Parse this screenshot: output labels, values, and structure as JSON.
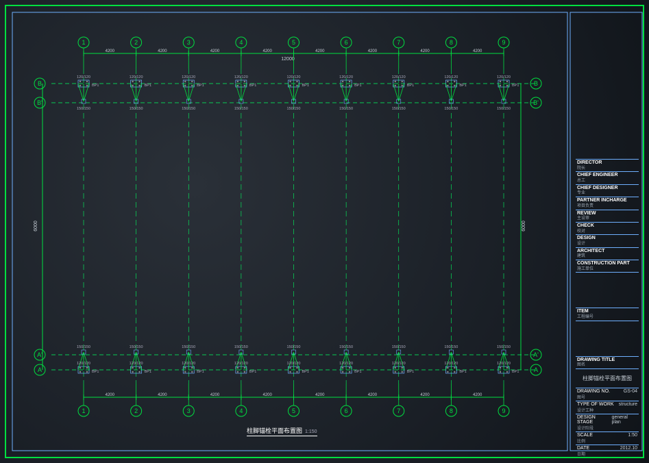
{
  "frame": {
    "outer_color": "#00e040",
    "inner_color": "#6fb0ff"
  },
  "grid": {
    "columns": [
      "1",
      "2",
      "3",
      "4",
      "5",
      "6",
      "7",
      "8",
      "9"
    ],
    "rows_top": [
      "B",
      "B'"
    ],
    "rows_bottom": [
      "A'",
      "A"
    ],
    "col_spacing_labels": [
      "4200",
      "4200",
      "4200",
      "4200",
      "4200",
      "4200",
      "4200",
      "4200"
    ],
    "mid_spacing_label": "12000",
    "row_spacing_label": "6000",
    "base_label_top": "120/120",
    "base_label_side": "BP1",
    "anchor_label": "150/150"
  },
  "caption": {
    "text": "柱脚锚栓平面布置图",
    "scale": "1:150"
  },
  "titleblock": {
    "roles": [
      {
        "en": "DIRECTOR",
        "zh": "院长"
      },
      {
        "en": "CHIEF ENGINEER",
        "zh": "总工"
      },
      {
        "en": "CHIEF DESIGNER",
        "zh": "专业"
      },
      {
        "en": "PARTNER INCHARGE",
        "zh": "项目负责"
      },
      {
        "en": "REVIEW",
        "zh": "主设审"
      },
      {
        "en": "CHECK",
        "zh": "校对"
      },
      {
        "en": "DESIGN",
        "zh": "设计"
      },
      {
        "en": "ARCHITECT",
        "zh": "建筑"
      },
      {
        "en": "CONSTRUCTION PART",
        "zh": "施工单位"
      }
    ],
    "item": {
      "en": "ITEM",
      "zh": "工程编号"
    },
    "drawing_title_label": {
      "en": "DRAWING TITLE",
      "zh": "图名"
    },
    "drawing_title_value": "柱脚锚栓平面布置图",
    "info": [
      {
        "k_en": "DRAWING NO.",
        "k_zh": "图号",
        "v": "GS-04"
      },
      {
        "k_en": "TYPE OF WORK",
        "k_zh": "设计工种",
        "v": "structure"
      },
      {
        "k_en": "DESIGN STAGE",
        "k_zh": "设计阶段",
        "v": "general plan"
      },
      {
        "k_en": "SCALE",
        "k_zh": "比例",
        "v": "1:50"
      },
      {
        "k_en": "DATE",
        "k_zh": "日期",
        "v": "2012.10"
      }
    ]
  }
}
